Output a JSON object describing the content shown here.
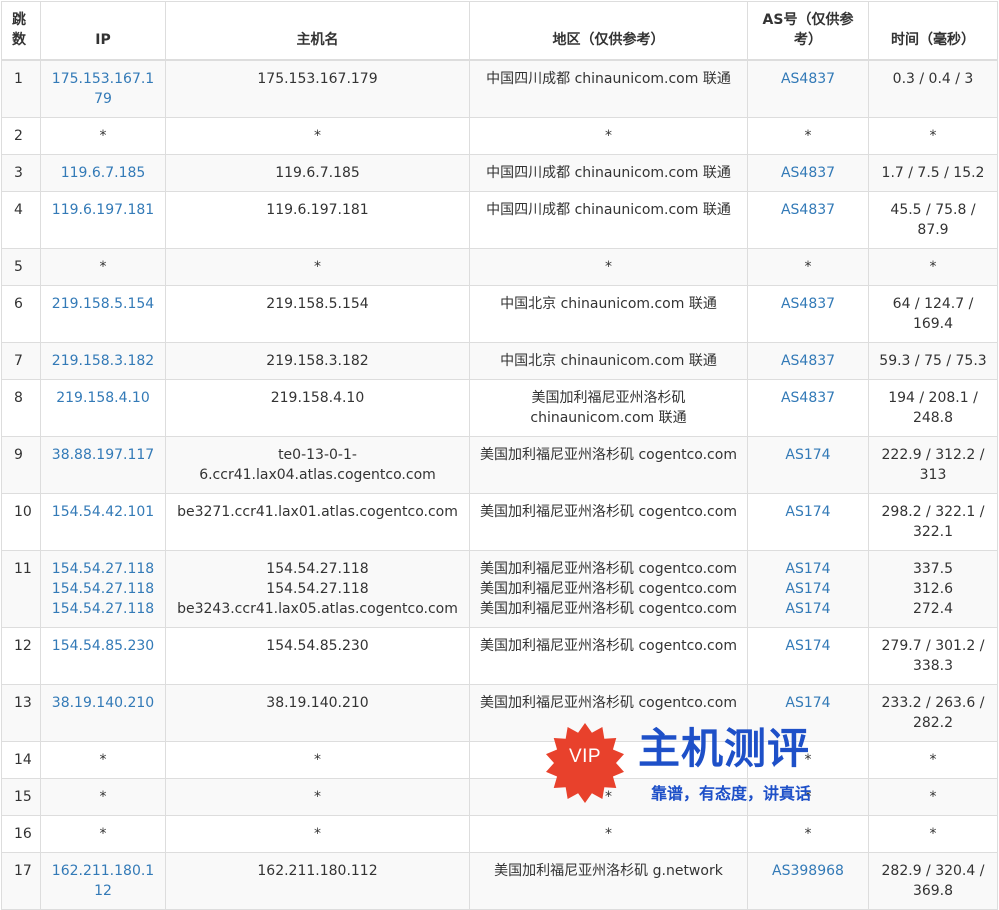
{
  "headers": {
    "hop": "跳数",
    "ip": "IP",
    "hostname": "主机名",
    "region": "地区（仅供参考）",
    "as": "AS号（仅供参考）",
    "time": "时间（毫秒）"
  },
  "rows": [
    {
      "hop": "1",
      "ip": [
        "175.153.167.179"
      ],
      "host": [
        "175.153.167.179"
      ],
      "region": [
        "中国四川成都 chinaunicom.com 联通"
      ],
      "as": [
        "AS4837"
      ],
      "time": [
        "0.3 / 0.4 / 3"
      ]
    },
    {
      "hop": "2",
      "ip": [
        "*"
      ],
      "host": [
        "*"
      ],
      "region": [
        "*"
      ],
      "as": [
        "*"
      ],
      "time": [
        "*"
      ]
    },
    {
      "hop": "3",
      "ip": [
        "119.6.7.185"
      ],
      "host": [
        "119.6.7.185"
      ],
      "region": [
        "中国四川成都 chinaunicom.com 联通"
      ],
      "as": [
        "AS4837"
      ],
      "time": [
        "1.7 / 7.5 / 15.2"
      ]
    },
    {
      "hop": "4",
      "ip": [
        "119.6.197.181"
      ],
      "host": [
        "119.6.197.181"
      ],
      "region": [
        "中国四川成都 chinaunicom.com 联通"
      ],
      "as": [
        "AS4837"
      ],
      "time": [
        "45.5 / 75.8 / 87.9"
      ]
    },
    {
      "hop": "5",
      "ip": [
        "*"
      ],
      "host": [
        "*"
      ],
      "region": [
        "*"
      ],
      "as": [
        "*"
      ],
      "time": [
        "*"
      ]
    },
    {
      "hop": "6",
      "ip": [
        "219.158.5.154"
      ],
      "host": [
        "219.158.5.154"
      ],
      "region": [
        "中国北京 chinaunicom.com 联通"
      ],
      "as": [
        "AS4837"
      ],
      "time": [
        "64 / 124.7 / 169.4"
      ]
    },
    {
      "hop": "7",
      "ip": [
        "219.158.3.182"
      ],
      "host": [
        "219.158.3.182"
      ],
      "region": [
        "中国北京 chinaunicom.com 联通"
      ],
      "as": [
        "AS4837"
      ],
      "time": [
        "59.3 / 75 / 75.3"
      ]
    },
    {
      "hop": "8",
      "ip": [
        "219.158.4.10"
      ],
      "host": [
        "219.158.4.10"
      ],
      "region": [
        "美国加利福尼亚州洛杉矶 chinaunicom.com 联通"
      ],
      "as": [
        "AS4837"
      ],
      "time": [
        "194 / 208.1 / 248.8"
      ]
    },
    {
      "hop": "9",
      "ip": [
        "38.88.197.117"
      ],
      "host": [
        "te0-13-0-1-6.ccr41.lax04.atlas.cogentco.com"
      ],
      "region": [
        "美国加利福尼亚州洛杉矶 cogentco.com"
      ],
      "as": [
        "AS174"
      ],
      "time": [
        "222.9 / 312.2 / 313"
      ]
    },
    {
      "hop": "10",
      "ip": [
        "154.54.42.101"
      ],
      "host": [
        "be3271.ccr41.lax01.atlas.cogentco.com"
      ],
      "region": [
        "美国加利福尼亚州洛杉矶 cogentco.com"
      ],
      "as": [
        "AS174"
      ],
      "time": [
        "298.2 / 322.1 / 322.1"
      ]
    },
    {
      "hop": "11",
      "ip": [
        "154.54.27.118",
        "154.54.27.118",
        "154.54.27.118"
      ],
      "host": [
        "154.54.27.118",
        "154.54.27.118",
        "be3243.ccr41.lax05.atlas.cogentco.com"
      ],
      "region": [
        "美国加利福尼亚州洛杉矶 cogentco.com",
        "美国加利福尼亚州洛杉矶 cogentco.com",
        "美国加利福尼亚州洛杉矶 cogentco.com"
      ],
      "as": [
        "AS174",
        "AS174",
        "AS174"
      ],
      "time": [
        "337.5",
        "312.6",
        "272.4"
      ]
    },
    {
      "hop": "12",
      "ip": [
        "154.54.85.230"
      ],
      "host": [
        "154.54.85.230"
      ],
      "region": [
        "美国加利福尼亚州洛杉矶 cogentco.com"
      ],
      "as": [
        "AS174"
      ],
      "time": [
        "279.7 / 301.2 / 338.3"
      ]
    },
    {
      "hop": "13",
      "ip": [
        "38.19.140.210"
      ],
      "host": [
        "38.19.140.210"
      ],
      "region": [
        "美国加利福尼亚州洛杉矶 cogentco.com"
      ],
      "as": [
        "AS174"
      ],
      "time": [
        "233.2 / 263.6 / 282.2"
      ]
    },
    {
      "hop": "14",
      "ip": [
        "*"
      ],
      "host": [
        "*"
      ],
      "region": [
        "*"
      ],
      "as": [
        "*"
      ],
      "time": [
        "*"
      ]
    },
    {
      "hop": "15",
      "ip": [
        "*"
      ],
      "host": [
        "*"
      ],
      "region": [
        "*"
      ],
      "as": [
        "*"
      ],
      "time": [
        "*"
      ]
    },
    {
      "hop": "16",
      "ip": [
        "*"
      ],
      "host": [
        "*"
      ],
      "region": [
        "*"
      ],
      "as": [
        "*"
      ],
      "time": [
        "*"
      ]
    },
    {
      "hop": "17",
      "ip": [
        "162.211.180.112"
      ],
      "host": [
        "162.211.180.112"
      ],
      "region": [
        "美国加利福尼亚州洛杉矶 g.network"
      ],
      "as": [
        "AS398968"
      ],
      "time": [
        "282.9 / 320.4 / 369.8"
      ]
    }
  ],
  "watermark": {
    "badge": "VIP",
    "title": "主机测评",
    "slogan": "靠谱，有态度，讲真话"
  },
  "colors": {
    "link": "#337ab7",
    "stripe": "#f9f9f9",
    "border": "#dddddd",
    "watermark_blue": "#1e50c8",
    "badge_red": "#e8412c"
  }
}
